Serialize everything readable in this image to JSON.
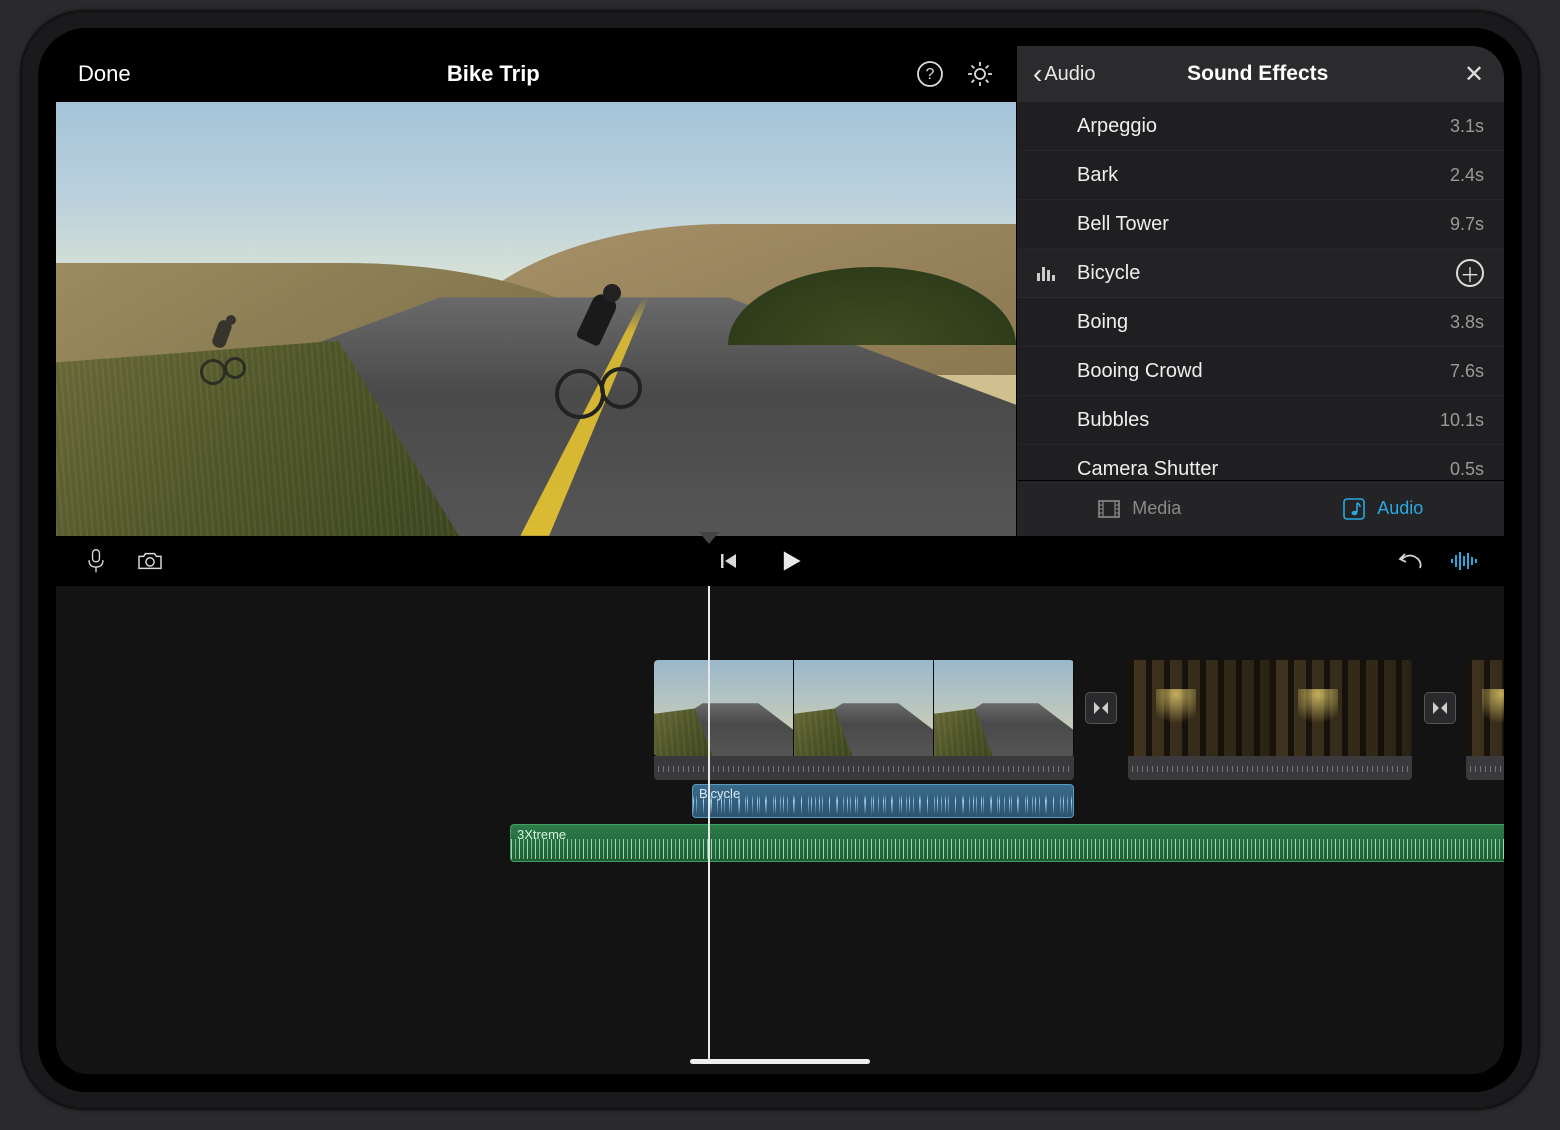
{
  "header": {
    "done_label": "Done",
    "project_title": "Bike Trip"
  },
  "sidebar": {
    "back_label": "Audio",
    "title": "Sound Effects",
    "items": [
      {
        "name": "Arpeggio",
        "duration": "3.1s",
        "selected": false
      },
      {
        "name": "Bark",
        "duration": "2.4s",
        "selected": false
      },
      {
        "name": "Bell Tower",
        "duration": "9.7s",
        "selected": false
      },
      {
        "name": "Bicycle",
        "duration": "",
        "selected": true
      },
      {
        "name": "Boing",
        "duration": "3.8s",
        "selected": false
      },
      {
        "name": "Booing Crowd",
        "duration": "7.6s",
        "selected": false
      },
      {
        "name": "Bubbles",
        "duration": "10.1s",
        "selected": false
      },
      {
        "name": "Camera Shutter",
        "duration": "0.5s",
        "selected": false
      }
    ],
    "tabs": {
      "media": "Media",
      "audio": "Audio"
    }
  },
  "timeline": {
    "sfx_clip_label": "Bicycle",
    "music_clip_label": "3Xtreme"
  },
  "colors": {
    "accent": "#2aa8e0",
    "sfx": "#3a6a8a",
    "music": "#2d7a4a"
  }
}
